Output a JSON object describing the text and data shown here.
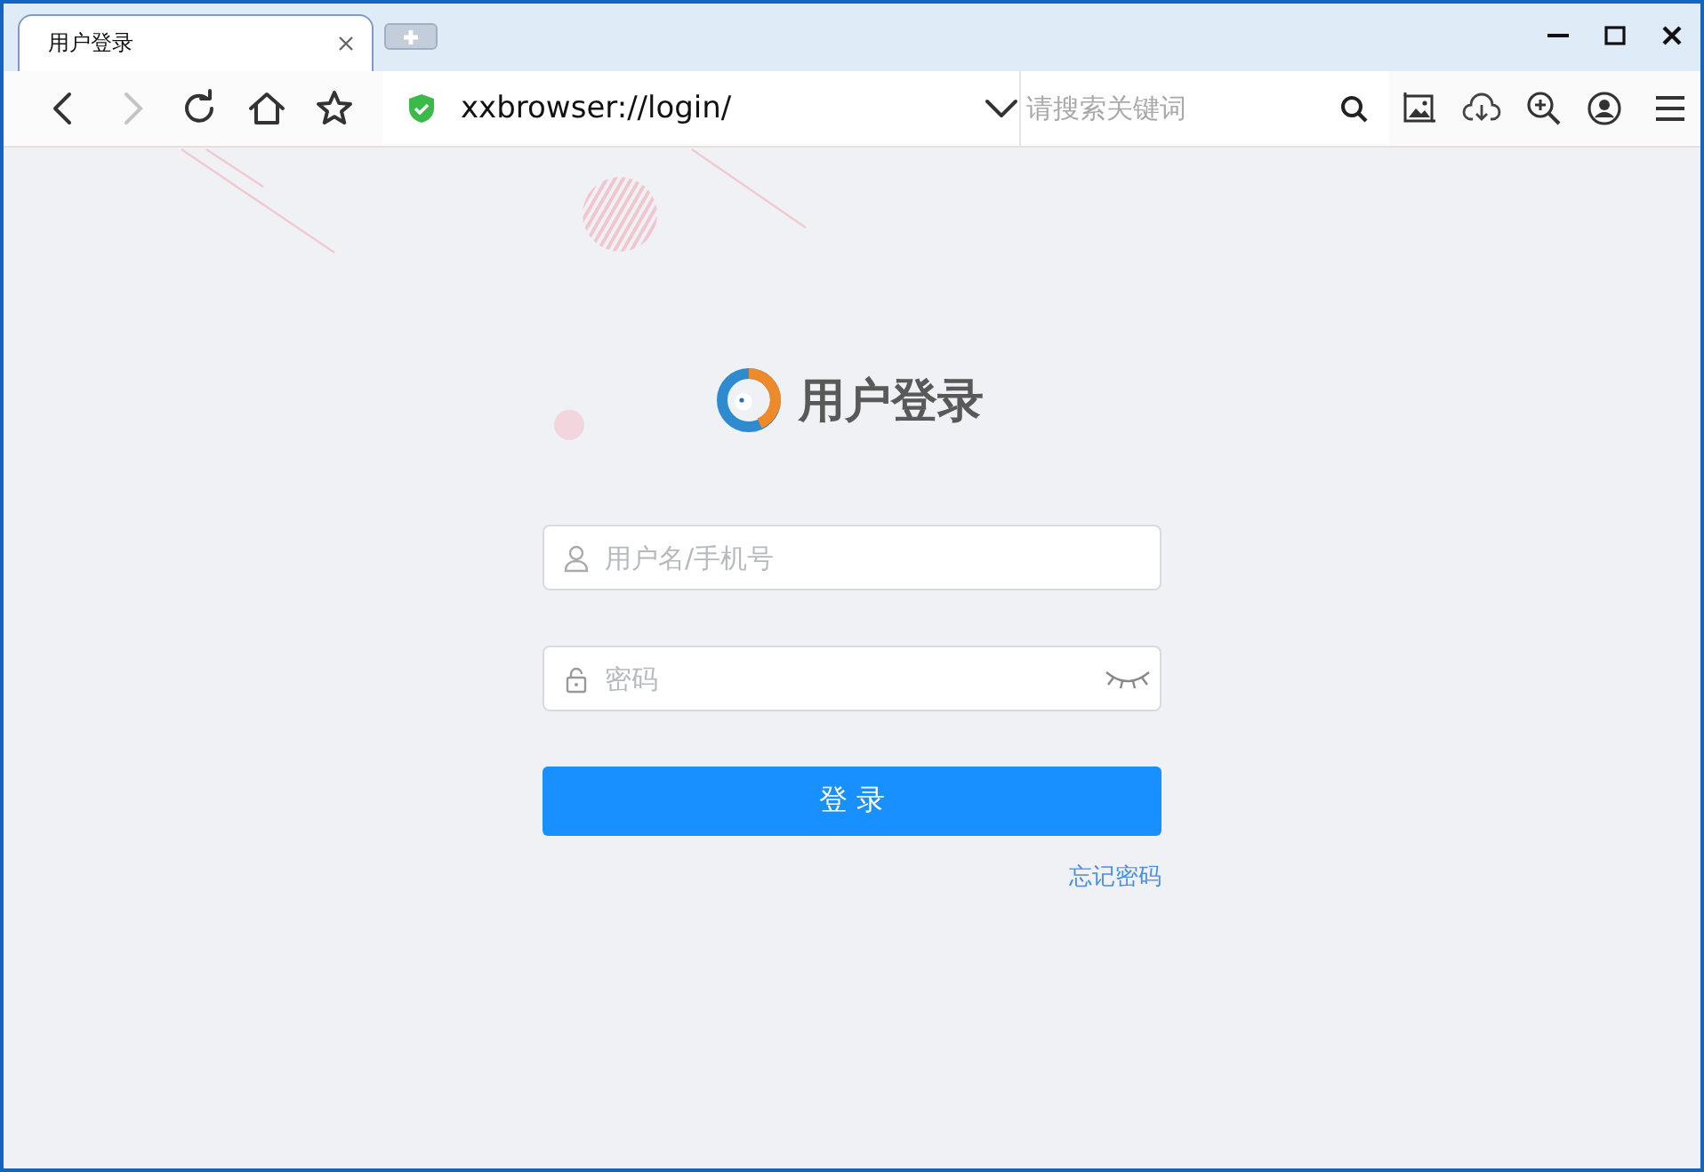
{
  "tabs": [
    {
      "label": "用户登录",
      "selected": true
    }
  ],
  "address_bar": {
    "url": "xxbrowser://login/"
  },
  "search": {
    "placeholder": "请搜索关键词"
  },
  "login": {
    "title": "用户登录",
    "username": {
      "placeholder": "用户名/手机号"
    },
    "password": {
      "placeholder": "密码"
    },
    "submit": "登 录",
    "forgot_link": "忘记密码"
  }
}
